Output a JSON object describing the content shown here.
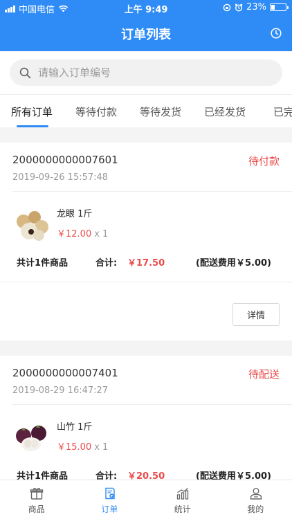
{
  "status_bar": {
    "carrier": "中国电信",
    "time": "上午 9:49",
    "battery": "23%",
    "battery_level": 0.23
  },
  "header": {
    "title": "订单列表",
    "history_icon": "clock-icon"
  },
  "search": {
    "placeholder": "请输入订单编号",
    "value": ""
  },
  "tabs": [
    {
      "label": "所有订单",
      "active": true
    },
    {
      "label": "等待付款",
      "active": false
    },
    {
      "label": "等待发货",
      "active": false
    },
    {
      "label": "已经发货",
      "active": false
    },
    {
      "label": "已完",
      "active": false
    }
  ],
  "orders": [
    {
      "order_no": "2000000000007601",
      "status": "待付款",
      "time": "2019-09-26 15:57:48",
      "items": [
        {
          "name": "龙眼 1斤",
          "price": "￥12.00",
          "qty": "x 1",
          "image": "longan-image"
        }
      ],
      "summary": {
        "count": "共计1件商品",
        "total_label": "合计:",
        "total": "￥17.50",
        "shipping": "(配送费用￥5.00)"
      },
      "detail_label": "详情"
    },
    {
      "order_no": "2000000000007401",
      "status": "待配送",
      "time": "2019-08-29 16:47:27",
      "items": [
        {
          "name": "山竹 1斤",
          "price": "￥15.00",
          "qty": "x 1",
          "image": "mangosteen-image"
        }
      ],
      "summary": {
        "count": "共计1件商品",
        "total_label": "合计:",
        "total": "￥20.50",
        "shipping": "(配送费用￥5.00)"
      }
    }
  ],
  "bottom_tabs": [
    {
      "label": "商品",
      "icon": "gift-icon",
      "active": false
    },
    {
      "label": "订单",
      "icon": "order-icon",
      "active": true
    },
    {
      "label": "统计",
      "icon": "chart-icon",
      "active": false
    },
    {
      "label": "我的",
      "icon": "user-icon",
      "active": false
    }
  ],
  "colors": {
    "primary": "#2f8cf6",
    "price": "#e94b4b",
    "background": "#f4f4f4"
  }
}
